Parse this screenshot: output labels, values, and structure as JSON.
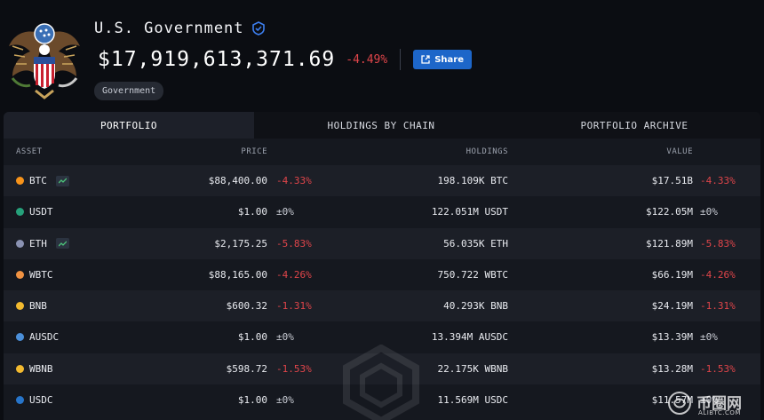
{
  "entity": {
    "name": "U.S. Government",
    "total_value": "$17,919,613,371.69",
    "total_change": "-4.49%",
    "share_label": "Share",
    "tag": "Government"
  },
  "tabs": [
    {
      "label": "PORTFOLIO",
      "active": true
    },
    {
      "label": "HOLDINGS BY CHAIN",
      "active": false
    },
    {
      "label": "PORTFOLIO ARCHIVE",
      "active": false
    }
  ],
  "columns": {
    "asset": "ASSET",
    "price": "PRICE",
    "holdings": "HOLDINGS",
    "value": "VALUE"
  },
  "rows": [
    {
      "asset": "BTC",
      "icon_color": "#f7931a",
      "trend": true,
      "price": "$88,400.00",
      "price_change": "-4.33%",
      "holdings": "198.109K BTC",
      "value": "$17.51B",
      "value_change": "-4.33%"
    },
    {
      "asset": "USDT",
      "icon_color": "#26a17b",
      "trend": false,
      "price": "$1.00",
      "price_change": "±0%",
      "holdings": "122.051M USDT",
      "value": "$122.05M",
      "value_change": "±0%"
    },
    {
      "asset": "ETH",
      "icon_color": "#8a92b2",
      "trend": true,
      "price": "$2,175.25",
      "price_change": "-5.83%",
      "holdings": "56.035K ETH",
      "value": "$121.89M",
      "value_change": "-5.83%"
    },
    {
      "asset": "WBTC",
      "icon_color": "#f09242",
      "trend": false,
      "price": "$88,165.00",
      "price_change": "-4.26%",
      "holdings": "750.722 WBTC",
      "value": "$66.19M",
      "value_change": "-4.26%"
    },
    {
      "asset": "BNB",
      "icon_color": "#f3ba2f",
      "trend": false,
      "price": "$600.32",
      "price_change": "-1.31%",
      "holdings": "40.293K BNB",
      "value": "$24.19M",
      "value_change": "-1.31%"
    },
    {
      "asset": "AUSDC",
      "icon_color": "#4b8fd9",
      "trend": false,
      "price": "$1.00",
      "price_change": "±0%",
      "holdings": "13.394M AUSDC",
      "value": "$13.39M",
      "value_change": "±0%"
    },
    {
      "asset": "WBNB",
      "icon_color": "#f3ba2f",
      "trend": false,
      "price": "$598.72",
      "price_change": "-1.53%",
      "holdings": "22.175K WBNB",
      "value": "$13.28M",
      "value_change": "-1.53%"
    },
    {
      "asset": "USDC",
      "icon_color": "#2775ca",
      "trend": false,
      "price": "$1.00",
      "price_change": "±0%",
      "holdings": "11.569M USDC",
      "value": "$11.57M",
      "value_change": "±0%"
    }
  ],
  "colors": {
    "negative": "#e0454a",
    "accent": "#1d66c9",
    "background": "#0b0d12"
  },
  "watermark": {
    "text": "币圈网",
    "url": "ALIBTC.COM"
  }
}
